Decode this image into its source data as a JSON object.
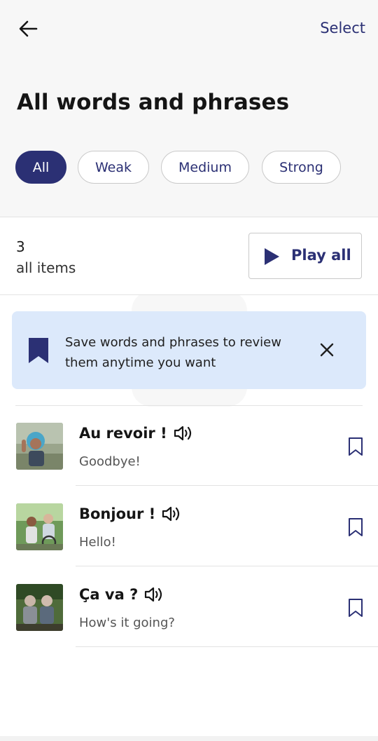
{
  "header": {
    "select_label": "Select",
    "title": "All words and phrases"
  },
  "filters": [
    {
      "label": "All",
      "active": true
    },
    {
      "label": "Weak",
      "active": false
    },
    {
      "label": "Medium",
      "active": false
    },
    {
      "label": "Strong",
      "active": false
    }
  ],
  "summary": {
    "count": "3",
    "count_label": "all items",
    "play_all_label": "Play all"
  },
  "banner": {
    "text": "Save words and phrases to review them anytime you want"
  },
  "items": [
    {
      "phrase": "Au revoir !",
      "translation": "Goodbye!"
    },
    {
      "phrase": "Bonjour !",
      "translation": "Hello!"
    },
    {
      "phrase": "Ça va ?",
      "translation": "How's it going?"
    }
  ],
  "colors": {
    "accent": "#2b3074",
    "banner_bg": "#dce9fb"
  }
}
